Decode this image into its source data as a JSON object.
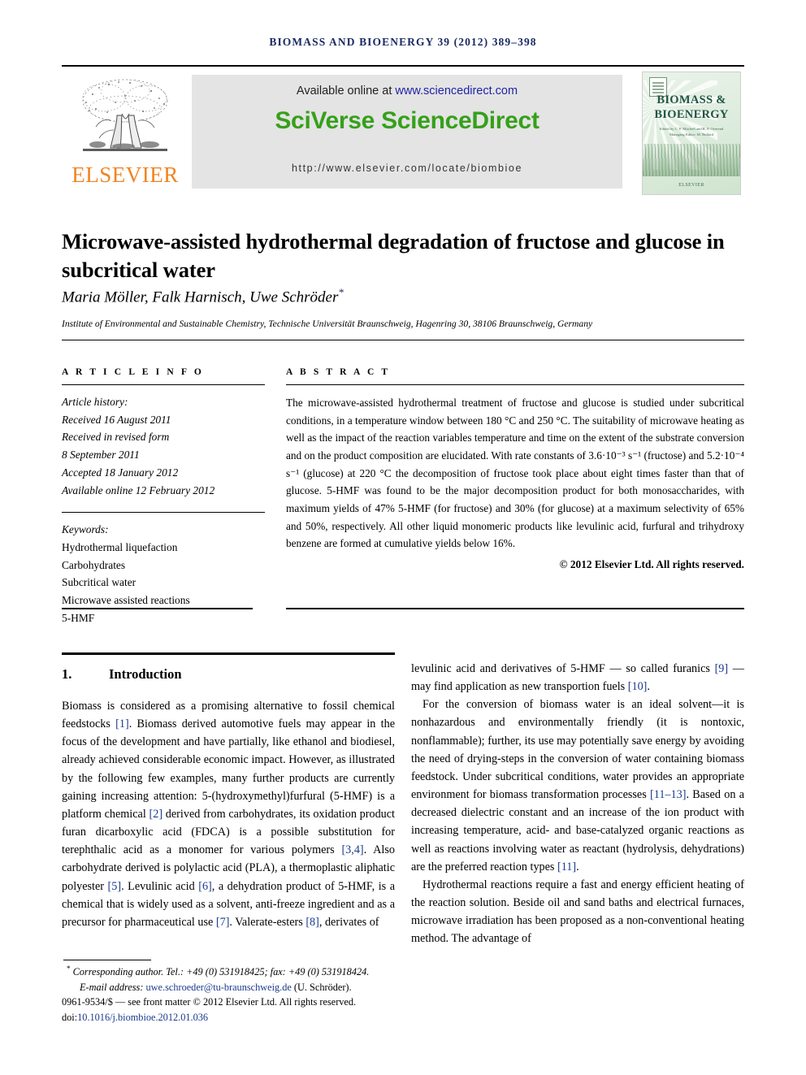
{
  "running_head": "BIOMASS AND BIOENERGY 39 (2012) 389–398",
  "masthead": {
    "publisher_wordmark": "ELSEVIER",
    "available_prefix": "Available online at ",
    "available_link": "www.sciencedirect.com",
    "platform_title": "SciVerse ScienceDirect",
    "journal_url": "http://www.elsevier.com/locate/biombioe",
    "cover": {
      "title_line1": "BIOMASS &",
      "title_line2": "BIOENERGY",
      "subtitle": "Edited by C. P. Mitchell and R. P. Overend Managing Editor: M. Bullard",
      "footer": "ELSEVIER"
    }
  },
  "article": {
    "title": "Microwave-assisted hydrothermal degradation of fructose and glucose in subcritical water",
    "authors": "Maria Möller, Falk Harnisch, Uwe Schröder",
    "corresponding_marker": "*",
    "affiliation": "Institute of Environmental and Sustainable Chemistry, Technische Universität Braunschweig, Hagenring 30, 38106 Braunschweig, Germany"
  },
  "article_info": {
    "heading": "A R T I C L E   I N F O",
    "history_label": "Article history:",
    "history": [
      "Received 16 August 2011",
      "Received in revised form",
      "8 September 2011",
      "Accepted 18 January 2012",
      "Available online 12 February 2012"
    ],
    "keywords_label": "Keywords:",
    "keywords": [
      "Hydrothermal liquefaction",
      "Carbohydrates",
      "Subcritical water",
      "Microwave assisted reactions",
      "5-HMF"
    ]
  },
  "abstract": {
    "heading": "A B S T R A C T",
    "text": "The microwave-assisted hydrothermal treatment of fructose and glucose is studied under subcritical conditions, in a temperature window between 180 °C and 250 °C. The suitability of microwave heating as well as the impact of the reaction variables temperature and time on the extent of the substrate conversion and on the product composition are elucidated. With rate constants of 3.6·10⁻³ s⁻¹ (fructose) and 5.2·10⁻⁴ s⁻¹ (glucose) at 220 °C the decomposition of fructose took place about eight times faster than that of glucose. 5-HMF was found to be the major decomposition product for both monosaccharides, with maximum yields of 47% 5-HMF (for fructose) and 30% (for glucose) at a maximum selectivity of 65% and 50%, respectively. All other liquid monomeric products like levulinic acid, furfural and trihydroxy benzene are formed at cumulative yields below 16%.",
    "copyright": "© 2012 Elsevier Ltd. All rights reserved."
  },
  "section": {
    "number": "1.",
    "title": "Introduction"
  },
  "body": {
    "left": [
      "Biomass is considered as a promising alternative to fossil chemical feedstocks [1]. Biomass derived automotive fuels may appear in the focus of the development and have partially, like ethanol and biodiesel, already achieved considerable economic impact. However, as illustrated by the following few examples, many further products are currently gaining increasing attention: 5-(hydroxymethyl)furfural (5-HMF) is a platform chemical [2] derived from carbohydrates, its oxidation product furan dicarboxylic acid (FDCA) is a possible substitution for terephthalic acid as a monomer for various polymers [3,4]. Also carbohydrate derived is polylactic acid (PLA), a thermoplastic aliphatic polyester [5]. Levulinic acid [6], a dehydration product of 5-HMF, is a chemical that is widely used as a solvent, anti-freeze ingredient and as a precursor for pharmaceutical use [7]. Valerate-esters [8], derivates of"
    ],
    "right": [
      "levulinic acid and derivatives of 5-HMF — so called furanics [9] — may find application as new transportion fuels [10].",
      "For the conversion of biomass water is an ideal solvent—it is nonhazardous and environmentally friendly (it is nontoxic, nonflammable); further, its use may potentially save energy by avoiding the need of drying-steps in the conversion of water containing biomass feedstock. Under subcritical conditions, water provides an appropriate environment for biomass transformation processes [11–13]. Based on a decreased dielectric constant and an increase of the ion product with increasing temperature, acid- and base-catalyzed organic reactions as well as reactions involving water as reactant (hydrolysis, dehydrations) are the preferred reaction types [11].",
      "Hydrothermal reactions require a fast and energy efficient heating of the reaction solution. Beside oil and sand baths and electrical furnaces, microwave irradiation has been proposed as a non-conventional heating method. The advantage of"
    ]
  },
  "footnote": {
    "corresponding": "Corresponding author. Tel.: +49 (0) 531918425; fax: +49 (0) 531918424.",
    "email_label": "E-mail address: ",
    "email": "uwe.schroeder@tu-braunschweig.de",
    "email_suffix": " (U. Schröder).",
    "front_matter": "0961-9534/$ — see front matter © 2012 Elsevier Ltd. All rights reserved.",
    "doi_label": "doi:",
    "doi": "10.1016/j.biombioe.2012.01.036"
  },
  "colors": {
    "runhead": "#1b2a63",
    "elsevier_orange": "#f08422",
    "sciencedirect_green": "#36a01a",
    "link_blue": "#2222aa",
    "citation_blue": "#1b3a8c"
  }
}
